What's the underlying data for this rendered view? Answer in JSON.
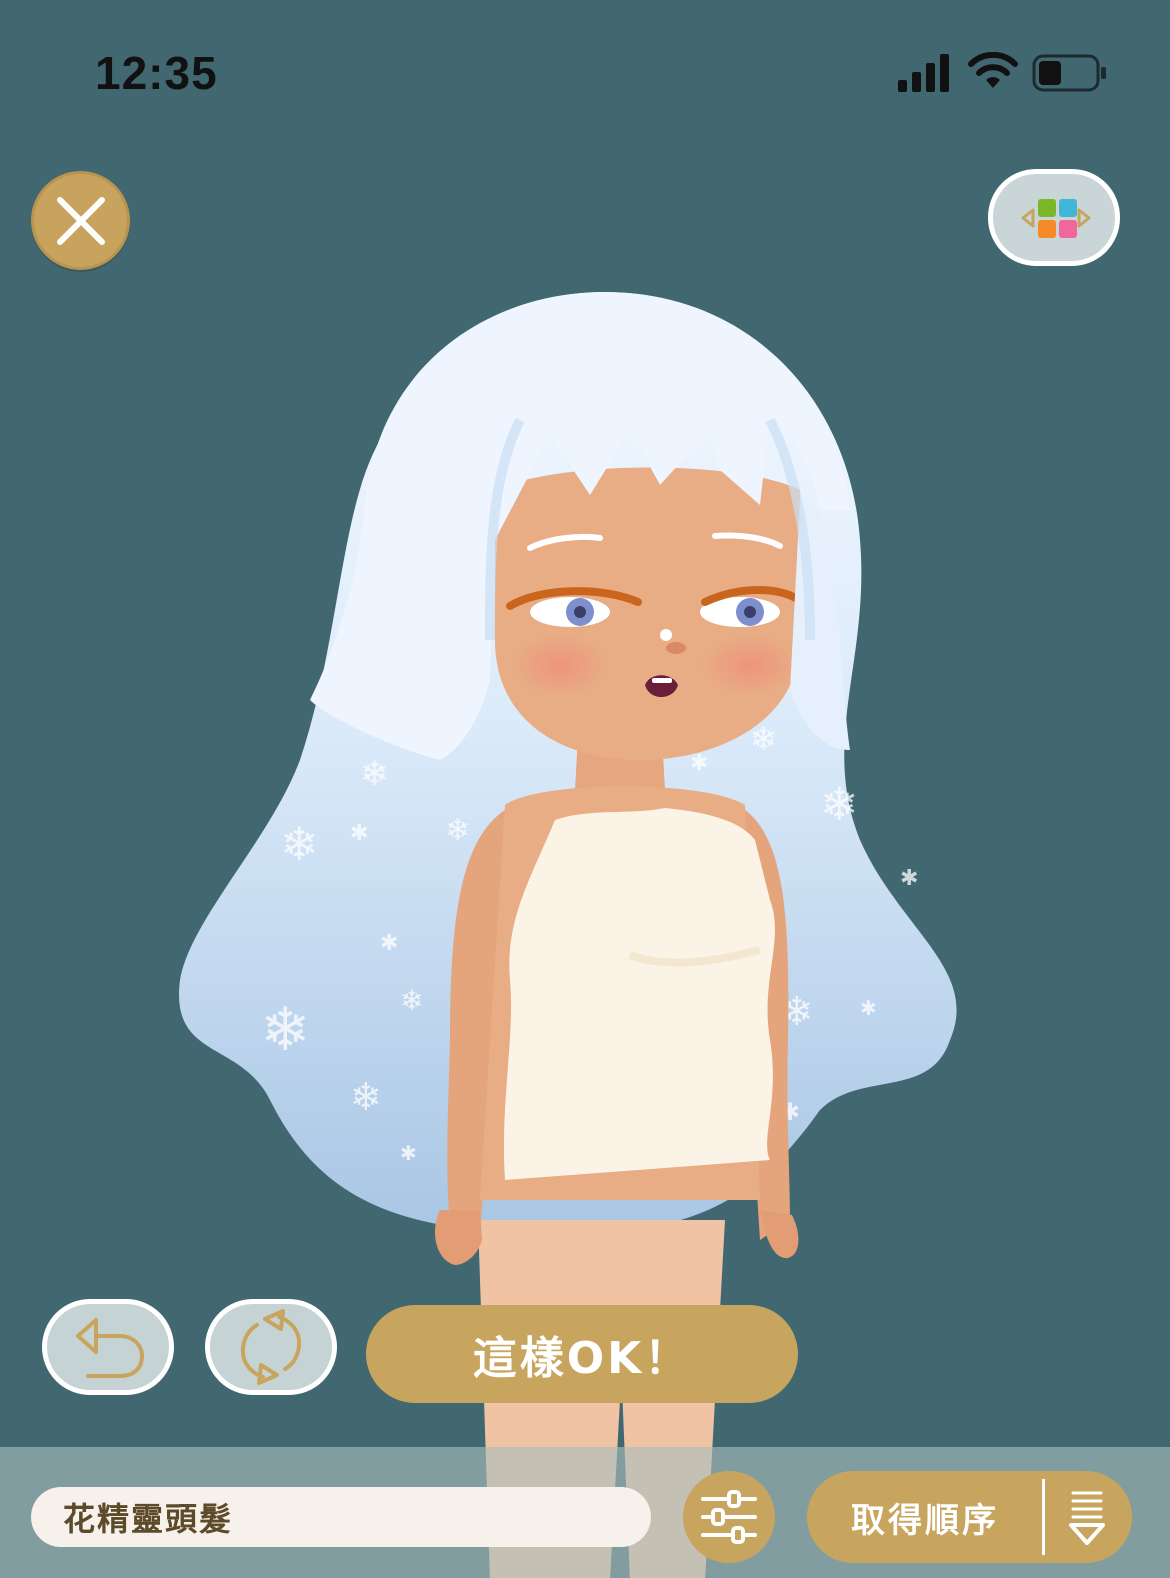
{
  "status_bar": {
    "time": "12:35",
    "icons": [
      "signal-icon",
      "wifi-icon",
      "battery-icon"
    ]
  },
  "top_bar": {
    "close_icon": "close-icon",
    "layout_toggle_icon": "color-grid-icon"
  },
  "character": {
    "hair_color": "#dbeaf8",
    "skin_color": "#e8ad85",
    "outfit_color": "#fbf4e6"
  },
  "actions": {
    "undo_icon": "undo-icon",
    "reset_icon": "refresh-icon",
    "confirm_label": "這樣OK！"
  },
  "bottom_bar": {
    "item_name": "花精靈頭髮",
    "filter_icon": "sliders-icon",
    "sort_label": "取得順序",
    "sort_dropdown_icon": "sort-down-icon"
  },
  "colors": {
    "background": "#416870",
    "accent_gold": "#c8a55f",
    "button_light": "#c6d3d4"
  }
}
